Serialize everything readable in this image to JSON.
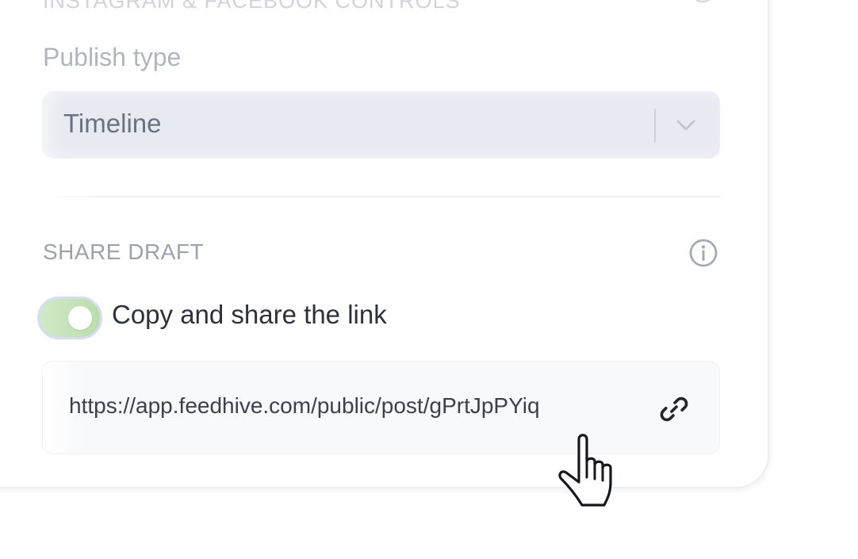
{
  "section_header_cut": "INSTAGRAM & FACEBOOK CONTROLS",
  "publish_type": {
    "label": "Publish type",
    "selected_value": "Timeline"
  },
  "share_draft": {
    "header": "SHARE DRAFT",
    "toggle_label": "Copy and share the link",
    "toggle_on": true,
    "link_url": "https://app.feedhive.com/public/post/gPrtJpPYiq"
  },
  "icons": {
    "info": "info-icon",
    "chevron": "chevron-down-icon",
    "link": "link-icon",
    "cursor": "hand-pointer-icon"
  },
  "colors": {
    "toggle_on": "#b9dea9",
    "select_bg": "#e8eaf1",
    "text_primary": "#2c313b",
    "text_muted": "#9ca2ad"
  }
}
